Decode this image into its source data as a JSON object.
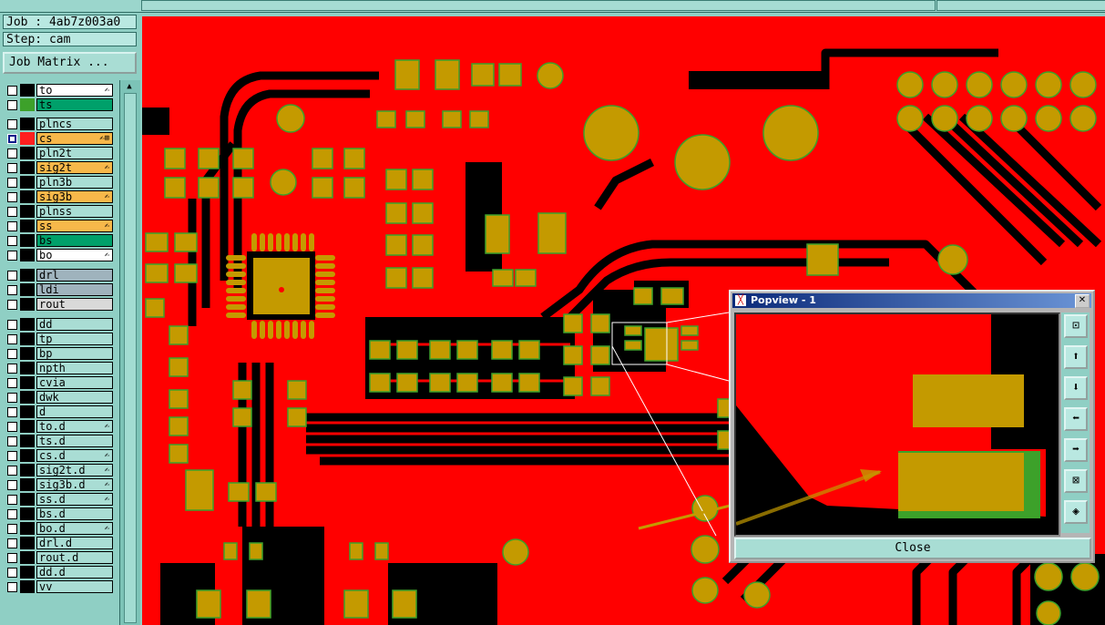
{
  "header": {
    "job": "Job : 4ab7z003a0",
    "step": "Step: cam"
  },
  "job_matrix_label": "Job Matrix ...",
  "layers": [
    {
      "name": "to",
      "color": "#ffffff",
      "swatch": "#000000",
      "checked": false,
      "flag": "✍"
    },
    {
      "name": "ts",
      "color": "#00a06a",
      "swatch": "#3da12a",
      "checked": false,
      "flag": ""
    },
    {
      "name": "plncs",
      "color": "#a9ddd4",
      "swatch": "#000000",
      "checked": false,
      "flag": ""
    },
    {
      "name": "cs",
      "color": "#f7b84a",
      "swatch": "#ff1f1f",
      "checked": true,
      "flag": "✍⊞"
    },
    {
      "name": "pln2t",
      "color": "#a9ddd4",
      "swatch": "#000000",
      "checked": false,
      "flag": ""
    },
    {
      "name": "sig2t",
      "color": "#f7b84a",
      "swatch": "#000000",
      "checked": false,
      "flag": "✍"
    },
    {
      "name": "pln3b",
      "color": "#a9ddd4",
      "swatch": "#000000",
      "checked": false,
      "flag": ""
    },
    {
      "name": "sig3b",
      "color": "#f7b84a",
      "swatch": "#000000",
      "checked": false,
      "flag": "✍"
    },
    {
      "name": "plnss",
      "color": "#a9ddd4",
      "swatch": "#000000",
      "checked": false,
      "flag": ""
    },
    {
      "name": "ss",
      "color": "#f7b84a",
      "swatch": "#000000",
      "checked": false,
      "flag": "✍"
    },
    {
      "name": "bs",
      "color": "#00a06a",
      "swatch": "#000000",
      "checked": false,
      "flag": ""
    },
    {
      "name": "bo",
      "color": "#ffffff",
      "swatch": "#000000",
      "checked": false,
      "flag": "✍"
    },
    {
      "name": "drl",
      "color": "#9fb3bd",
      "swatch": "#000000",
      "checked": false,
      "flag": ""
    },
    {
      "name": "ldi",
      "color": "#9fb3bd",
      "swatch": "#000000",
      "checked": false,
      "flag": ""
    },
    {
      "name": "rout",
      "color": "#d9d9d9",
      "swatch": "#000000",
      "checked": false,
      "flag": ""
    },
    {
      "name": "dd",
      "color": "#a9ddd4",
      "swatch": "#000000",
      "checked": false,
      "flag": ""
    },
    {
      "name": "tp",
      "color": "#a9ddd4",
      "swatch": "#000000",
      "checked": false,
      "flag": ""
    },
    {
      "name": "bp",
      "color": "#a9ddd4",
      "swatch": "#000000",
      "checked": false,
      "flag": ""
    },
    {
      "name": "npth",
      "color": "#a9ddd4",
      "swatch": "#000000",
      "checked": false,
      "flag": ""
    },
    {
      "name": "cvia",
      "color": "#a9ddd4",
      "swatch": "#000000",
      "checked": false,
      "flag": ""
    },
    {
      "name": "dwk",
      "color": "#a9ddd4",
      "swatch": "#000000",
      "checked": false,
      "flag": ""
    },
    {
      "name": "d",
      "color": "#a9ddd4",
      "swatch": "#000000",
      "checked": false,
      "flag": ""
    },
    {
      "name": "to.d",
      "color": "#a9ddd4",
      "swatch": "#000000",
      "checked": false,
      "flag": "✍"
    },
    {
      "name": "ts.d",
      "color": "#a9ddd4",
      "swatch": "#000000",
      "checked": false,
      "flag": ""
    },
    {
      "name": "cs.d",
      "color": "#a9ddd4",
      "swatch": "#000000",
      "checked": false,
      "flag": "✍"
    },
    {
      "name": "sig2t.d",
      "color": "#a9ddd4",
      "swatch": "#000000",
      "checked": false,
      "flag": "✍"
    },
    {
      "name": "sig3b.d",
      "color": "#a9ddd4",
      "swatch": "#000000",
      "checked": false,
      "flag": "✍"
    },
    {
      "name": "ss.d",
      "color": "#a9ddd4",
      "swatch": "#000000",
      "checked": false,
      "flag": "✍"
    },
    {
      "name": "bs.d",
      "color": "#a9ddd4",
      "swatch": "#000000",
      "checked": false,
      "flag": ""
    },
    {
      "name": "bo.d",
      "color": "#a9ddd4",
      "swatch": "#000000",
      "checked": false,
      "flag": "✍"
    },
    {
      "name": "drl.d",
      "color": "#a9ddd4",
      "swatch": "#000000",
      "checked": false,
      "flag": ""
    },
    {
      "name": "rout.d",
      "color": "#a9ddd4",
      "swatch": "#000000",
      "checked": false,
      "flag": ""
    },
    {
      "name": "dd.d",
      "color": "#a9ddd4",
      "swatch": "#000000",
      "checked": false,
      "flag": ""
    },
    {
      "name": "vv",
      "color": "#a9ddd4",
      "swatch": "#000000",
      "checked": false,
      "flag": ""
    }
  ],
  "popup": {
    "title": "Popview - 1",
    "close_label": "Close",
    "tools": [
      "zoom-fit-icon",
      "pan-up-icon",
      "pan-down-icon",
      "pan-left-icon",
      "pan-right-icon",
      "zoom-in-icon",
      "zoom-out-icon"
    ]
  },
  "colors": {
    "board": "#ff0000",
    "pad": "#c49a00",
    "trace_gap": "#000000",
    "solder": "#3da12a"
  }
}
